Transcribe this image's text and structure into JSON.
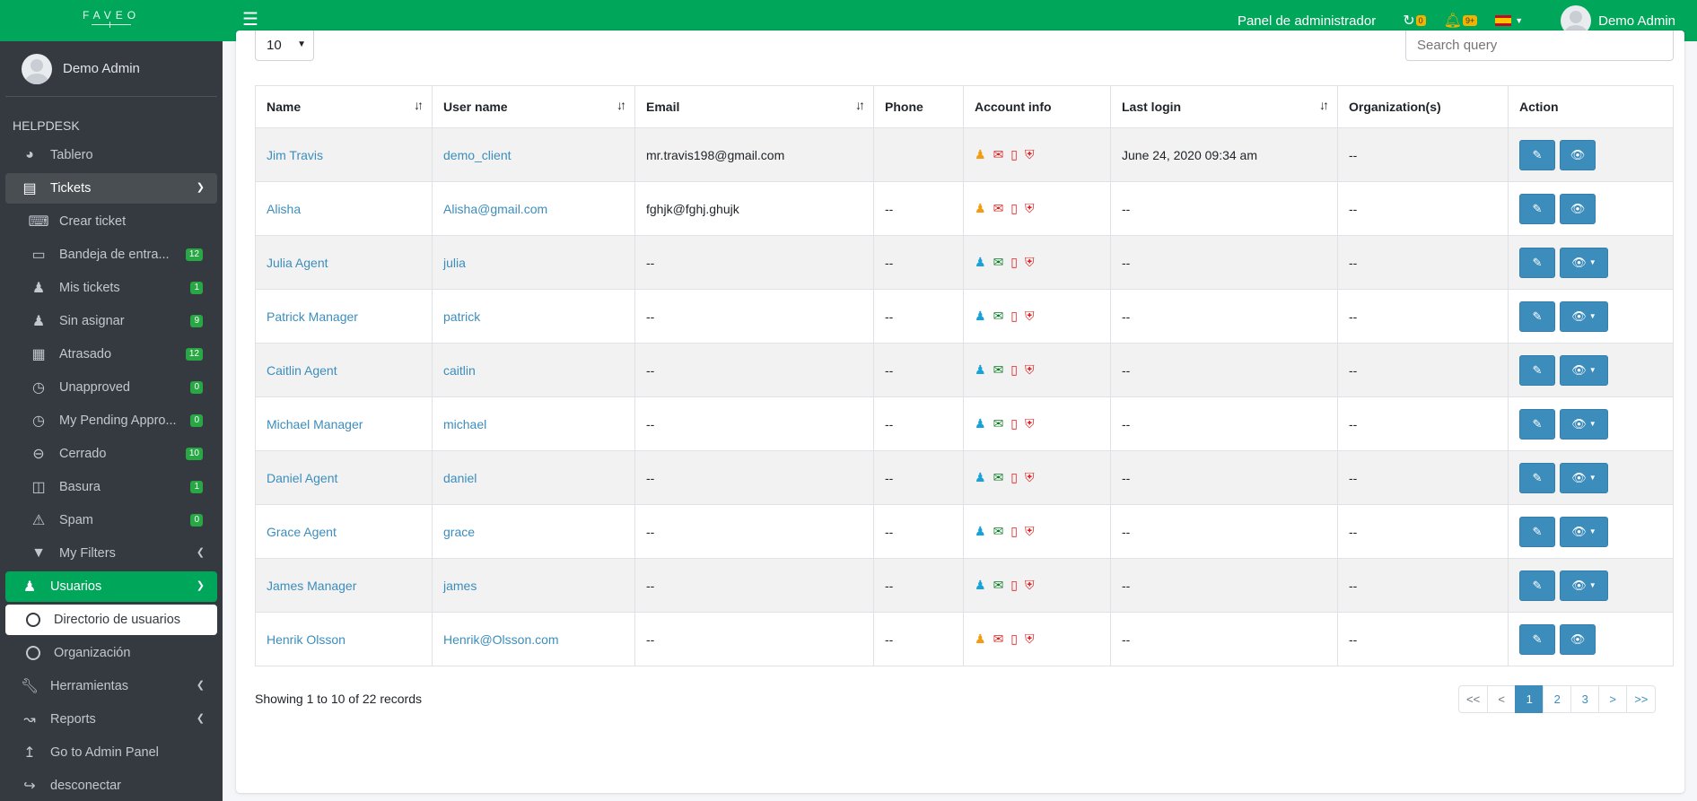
{
  "topbar": {
    "logo": "FAVEO",
    "admin_panel": "Panel de administrador",
    "sync_badge": "0",
    "notif_badge": "9+",
    "user_name": "Demo Admin",
    "brand_color": "#00a65a"
  },
  "sidebar": {
    "user_name": "Demo Admin",
    "section_header": "HELPDESK",
    "items": {
      "dashboard": "Tablero",
      "tickets": "Tickets",
      "create_ticket": "Crear ticket",
      "inbox": "Bandeja de entra...",
      "inbox_count": "12",
      "my_tickets": "Mis tickets",
      "my_tickets_count": "1",
      "unassigned": "Sin asignar",
      "unassigned_count": "9",
      "overdue": "Atrasado",
      "overdue_count": "12",
      "unapproved": "Unapproved",
      "unapproved_count": "0",
      "pending": "My Pending Appro...",
      "pending_count": "0",
      "closed": "Cerrado",
      "closed_count": "10",
      "trash": "Basura",
      "trash_count": "1",
      "spam": "Spam",
      "spam_count": "0",
      "filters": "My Filters",
      "users": "Usuarios",
      "user_directory": "Directorio de usuarios",
      "organization": "Organización",
      "tools": "Herramientas",
      "reports": "Reports",
      "admin_panel": "Go to Admin Panel",
      "logout": "desconectar"
    }
  },
  "controls": {
    "page_length": "10",
    "search_placeholder": "Search query"
  },
  "table": {
    "headers": {
      "name": "Name",
      "username": "User name",
      "email": "Email",
      "phone": "Phone",
      "account": "Account info",
      "last_login": "Last login",
      "orgs": "Organization(s)",
      "action": "Action"
    },
    "rows": [
      {
        "name": "Jim Travis",
        "username": "demo_client",
        "email": "mr.travis198@gmail.com",
        "phone": "",
        "last_login": "June 24, 2020 09:34 am",
        "orgs": "--"
      },
      {
        "name": "Alisha",
        "username": "Alisha@gmail.com",
        "email": "fghjk@fghj.ghujk",
        "phone": "--",
        "last_login": "--",
        "orgs": "--"
      },
      {
        "name": "Julia Agent",
        "username": "julia",
        "email": "--",
        "phone": "--",
        "last_login": "--",
        "orgs": "--"
      },
      {
        "name": "Patrick Manager",
        "username": "patrick",
        "email": "--",
        "phone": "--",
        "last_login": "--",
        "orgs": "--"
      },
      {
        "name": "Caitlin Agent",
        "username": "caitlin",
        "email": "--",
        "phone": "--",
        "last_login": "--",
        "orgs": "--"
      },
      {
        "name": "Michael Manager",
        "username": "michael",
        "email": "--",
        "phone": "--",
        "last_login": "--",
        "orgs": "--"
      },
      {
        "name": "Daniel Agent",
        "username": "daniel",
        "email": "--",
        "phone": "--",
        "last_login": "--",
        "orgs": "--"
      },
      {
        "name": "Grace Agent",
        "username": "grace",
        "email": "--",
        "phone": "--",
        "last_login": "--",
        "orgs": "--"
      },
      {
        "name": "James Manager",
        "username": "james",
        "email": "--",
        "phone": "--",
        "last_login": "--",
        "orgs": "--"
      },
      {
        "name": "Henrik Olsson",
        "username": "Henrik@Olsson.com",
        "email": "--",
        "phone": "--",
        "last_login": "--",
        "orgs": "--"
      }
    ]
  },
  "footer": {
    "info": "Showing 1 to 10 of 22 records",
    "pages": {
      "first": "<<",
      "prev": "<",
      "p1": "1",
      "p2": "2",
      "p3": "3",
      "next": ">",
      "last": ">>"
    }
  }
}
